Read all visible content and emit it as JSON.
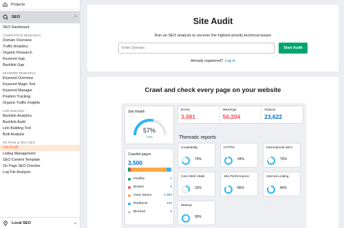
{
  "sidebar": {
    "projects_label": "Projects",
    "seo_label": "SEO",
    "seo_dashboard": "SEO Dashboard",
    "sections": [
      {
        "title": "COMPETITIVE RESEARCH",
        "items": [
          "Domain Overview",
          "Traffic Analytics",
          "Organic Research",
          "Keyword Gap",
          "Backlink Gap"
        ]
      },
      {
        "title": "KEYWORD RESEARCH",
        "items": [
          "Keyword Overview",
          "Keyword Magic Tool",
          "Keyword Manager",
          "Position Tracking",
          "Organic Traffic Insights"
        ]
      },
      {
        "title": "LINK BUILDING",
        "items": [
          "Backlink Analytics",
          "Backlink Audit",
          "Link Building Tool",
          "Bulk Analysis"
        ]
      },
      {
        "title": "ON PAGE & TECH SEO",
        "items": [
          "Site Audit",
          "Listing Management",
          "SEO Content Template",
          "On Page SEO Checker",
          "Log File Analyzer"
        ]
      }
    ],
    "active_item": "Site Audit",
    "local_seo_label": "Local SEO"
  },
  "audit": {
    "title": "Site Audit",
    "subtitle": "Run an SEO analysis to uncover the highest-priority technical issues",
    "domain_placeholder": "Enter Domain",
    "start_button": "Start Audit",
    "registered_text": "Already registered?",
    "login_link": "Log in"
  },
  "crawl": {
    "title": "Crawl and check every page on your website",
    "site_health": {
      "label": "Site Health",
      "value": "57%",
      "fraction": 0.57,
      "delta": "+4%"
    },
    "stats": [
      {
        "label": "Errors",
        "value": "3,081",
        "color": "#ff4953"
      },
      {
        "label": "Warnings",
        "value": "50,204",
        "color": "#ff4953"
      },
      {
        "label": "Notices",
        "value": "23,622",
        "color": "#006dca"
      }
    ],
    "crawled": {
      "label": "Crawled pages",
      "value": "3,500",
      "legend": [
        {
          "label": "Healthy",
          "value": "1",
          "color": "#00a66d"
        },
        {
          "label": "Broken",
          "value": "8",
          "color": "#ff4953"
        },
        {
          "label": "Have issues",
          "value": "3,359",
          "color": "#ffa744"
        },
        {
          "label": "Redirects",
          "value": "130",
          "color": "#2bb7f5"
        },
        {
          "label": "Blocked",
          "value": "8",
          "color": "#c5c7d0"
        }
      ]
    },
    "thematic_title": "Thematic reports",
    "thematic": [
      {
        "label": "Crawlability",
        "value": "70%",
        "fraction": 0.7
      },
      {
        "label": "HTTPS",
        "value": "94%",
        "fraction": 0.94
      },
      {
        "label": "International SEO",
        "value": "76%",
        "fraction": 0.76
      },
      {
        "label": "Core Web Vitals",
        "value": "33%",
        "fraction": 0.33
      },
      {
        "label": "Site Performance",
        "value": "86%",
        "fraction": 0.86
      },
      {
        "label": "Internal Linking",
        "value": "84%",
        "fraction": 0.84
      },
      {
        "label": "Markup",
        "value": "99%",
        "fraction": 0.99
      }
    ]
  }
}
